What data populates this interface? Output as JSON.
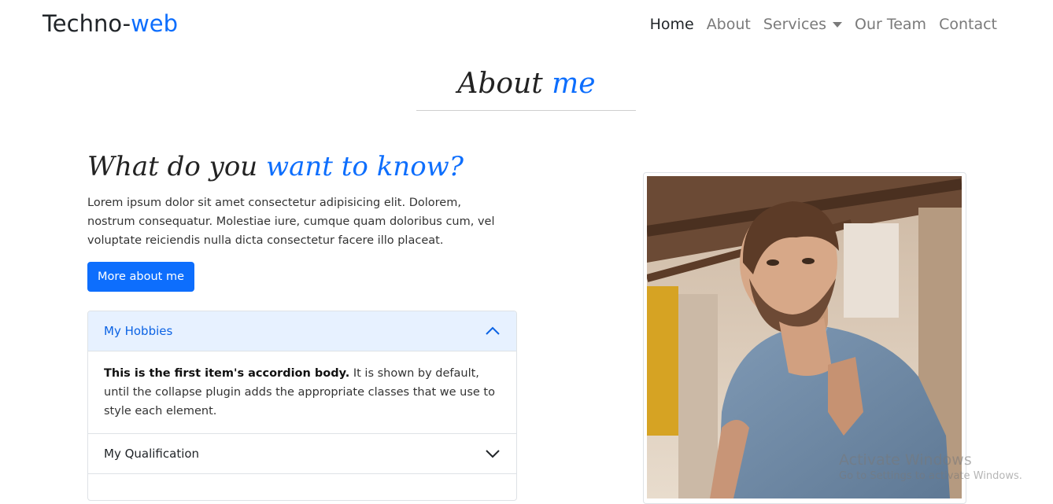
{
  "brand": {
    "part1": "Techno-",
    "part2": "web"
  },
  "nav": {
    "items": [
      {
        "label": "Home"
      },
      {
        "label": "About"
      },
      {
        "label": "Services"
      },
      {
        "label": "Our Team"
      },
      {
        "label": "Contact"
      }
    ]
  },
  "section": {
    "title_part1": "About ",
    "title_part2": "me"
  },
  "intro": {
    "heading_part1": "What do you ",
    "heading_part2": "want to know?",
    "text": "Lorem ipsum dolor sit amet consectetur adipisicing elit. Dolorem, nostrum consequatur. Molestiae iure, cumque quam doloribus cum, vel voluptate reiciendis nulla dicta consectetur facere illo placeat.",
    "button_label": "More about me"
  },
  "accordion": {
    "item1": {
      "title": "My Hobbies",
      "body_bold": "This is the first item's accordion body.",
      "body_text": " It is shown by default, until the collapse plugin adds the appropriate classes that we use to style each element."
    },
    "item2": {
      "title": "My Qualification"
    }
  },
  "photo": {
    "icon": "portrait-photo"
  },
  "watermark": {
    "title": "Activate Windows",
    "subtitle": "Go to Settings to activate Windows."
  },
  "colors": {
    "accent": "#0d6efd",
    "accordion_open_bg": "#e7f1ff",
    "accordion_open_text": "#0c63e4"
  }
}
